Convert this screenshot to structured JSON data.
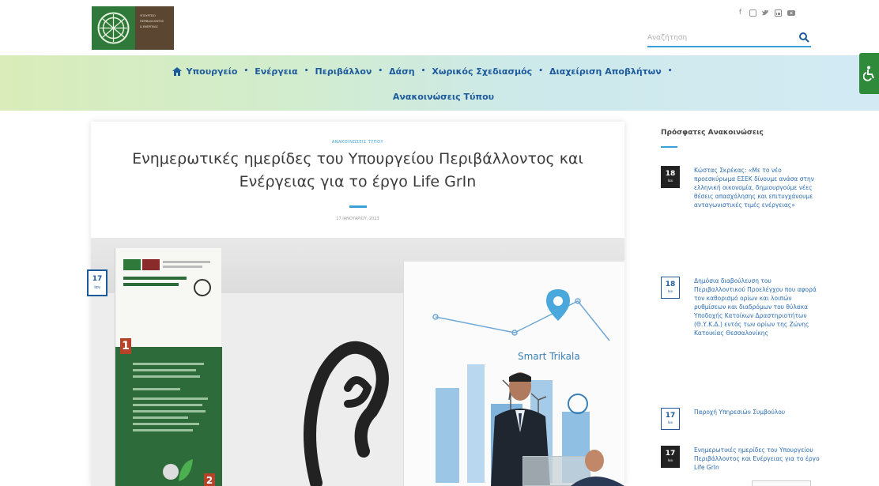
{
  "header": {
    "logo": {
      "text_lines": [
        "ΥΠΟΥΡΓΕΙΟ",
        "ΠΕΡΙΒΑΛΛΟΝΤΟΣ",
        "& ΕΝΕΡΓΕΙΑΣ"
      ]
    },
    "social_icons": [
      "facebook-icon",
      "instagram-icon",
      "twitter-icon",
      "linkedin-icon",
      "youtube-icon"
    ],
    "search": {
      "placeholder": "Αναζήτηση"
    }
  },
  "nav": {
    "row1": [
      {
        "label": "Υπουργείο",
        "icon": "home-icon",
        "has_dropdown": true
      },
      {
        "label": "Ενέργεια",
        "has_dropdown": true
      },
      {
        "label": "Περιβάλλον",
        "has_dropdown": true
      },
      {
        "label": "Δάση",
        "has_dropdown": true
      },
      {
        "label": "Χωρικός Σχεδιασμός",
        "has_dropdown": true
      },
      {
        "label": "Διαχείριση Αποβλήτων",
        "has_dropdown": true
      }
    ],
    "row2": [
      {
        "label": "Ανακοινώσεις Τύπου"
      }
    ]
  },
  "article": {
    "category": "ΑΝΑΚΟΙΝΩΣΕΙΣ ΤΥΠΟΥ",
    "title": "Ενημερωτικές ημερίδες του Υπουργείου Περιβάλλοντος και Ενέργειας για το έργο Life GrIn",
    "date": "17 ΙΑΝΟΥΑΡΙΟΥ, 2023",
    "image_badge": {
      "day": "17",
      "month": "Ιαν"
    },
    "image": {
      "banner_numbers": [
        "1",
        "2"
      ],
      "screen_text": "Smart Trikala"
    }
  },
  "sidebar": {
    "title": "Πρόσφατες Ανακοινώσεις",
    "items": [
      {
        "day": "18",
        "month": "Ιαν",
        "dark": true,
        "title": "Κώστας Σκρέκας: «Με το νέο προεσκύρωμα ΕΣΕΚ δίνουμε ανάσα στην ελληνική οικονομία, δημιουργούμε νέες θέσεις απασχόλησης και επιτυγχάνουμε ανταγωνιστικές τιμές ενέργειας»"
      },
      {
        "day": "18",
        "month": "Ιαν",
        "dark": false,
        "title": "Δημόσια διαβούλευση του Περιβαλλοντικού Προελέγχου που αφορά τον καθορισμό ορίων και λοιπών ρυθμίσεων και διαδρόμων του θύλακα Υποδοχής Κατοίκων Δραστηριοτήτων (Θ.Υ.Κ.Δ.) εντός των ορίων της Ζώνης Κατοικίας Θεσσαλονίκης"
      },
      {
        "day": "17",
        "month": "Ιαν",
        "dark": false,
        "title": "Παροχή Υπηρεσιών Συμβούλου"
      },
      {
        "day": "17",
        "month": "Ιαν",
        "dark": true,
        "title": "Ενημερωτικές ημερίδες του Υπουργείου Περιβάλλοντος και Ενέργειας για το έργο Life GrIn"
      }
    ]
  },
  "colors": {
    "accent_blue": "#3aa0d8",
    "nav_text": "#1d5a9c",
    "logo_green": "#2f7a3a",
    "logo_brown": "#5b4632",
    "accessibility_green": "#2f8a3a"
  }
}
